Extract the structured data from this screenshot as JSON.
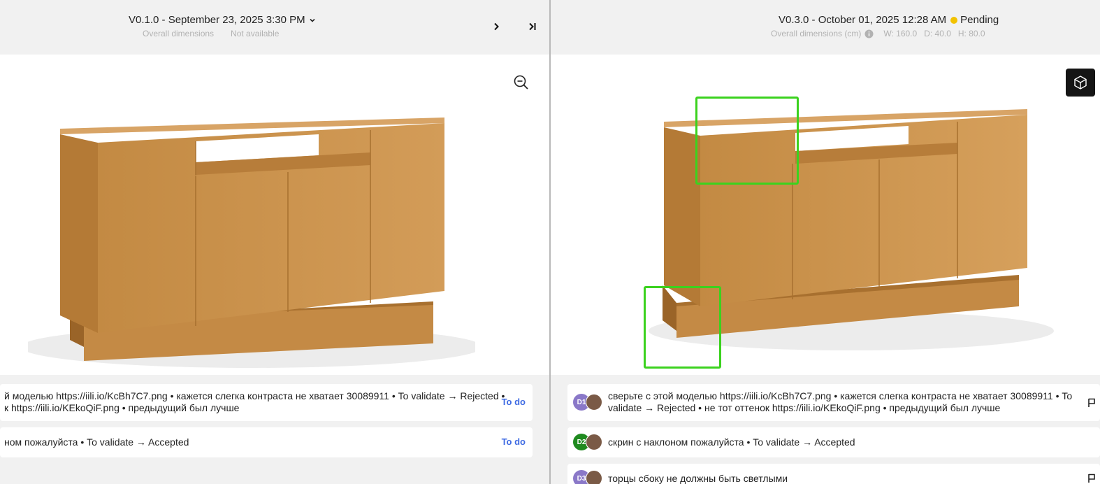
{
  "left": {
    "version_title": "V0.1.0 - September 23, 2025 3:30 PM",
    "dims_label": "Overall dimensions",
    "dims_value": "Not available",
    "comments": [
      {
        "line1": "й моделью https://iili.io/KcBh7C7.png • кажется слегка контраста не хватает 30089911 • To validate → Rejected •",
        "line2": "к https://iili.io/KEkoQiF.png • предыдущий был лучше",
        "status": "To do"
      },
      {
        "line1": "ном пожалуйста • To validate → Accepted",
        "status": "To do"
      }
    ]
  },
  "right": {
    "version_title": "V0.3.0 - October 01, 2025 12:28 AM",
    "status": "Pending",
    "status_color": "#f2c200",
    "dims_label": "Overall dimensions (cm)",
    "dims": {
      "w": "W: 160.0",
      "d": "D: 40.0",
      "h": "H: 80.0"
    },
    "comments": [
      {
        "code": "D1",
        "color": "#8a78c8",
        "line1": "сверьте с этой моделью https://iili.io/KcBh7C7.png • кажется слегка контраста не хватает 30089911 • To",
        "line2": "validate → Rejected • не тот оттенок https://iili.io/KEkoQiF.png • предыдущий был лучше"
      },
      {
        "code": "D2",
        "color": "#1f8a1f",
        "line1": "скрин с наклоном пожалуйста • To validate → Accepted"
      },
      {
        "code": "D3",
        "color": "#8a78c8",
        "line1": "торцы сбоку не должны быть светлыми"
      }
    ]
  },
  "colors": {
    "highlight": "#3bd21e",
    "accent": "#3f6be3",
    "wood": "#c9914a"
  },
  "icons": [
    "chevron-down-icon",
    "chevron-right-icon",
    "skip-last-icon",
    "zoom-out-icon",
    "info-icon",
    "cube-3d-icon",
    "flag-icon"
  ]
}
